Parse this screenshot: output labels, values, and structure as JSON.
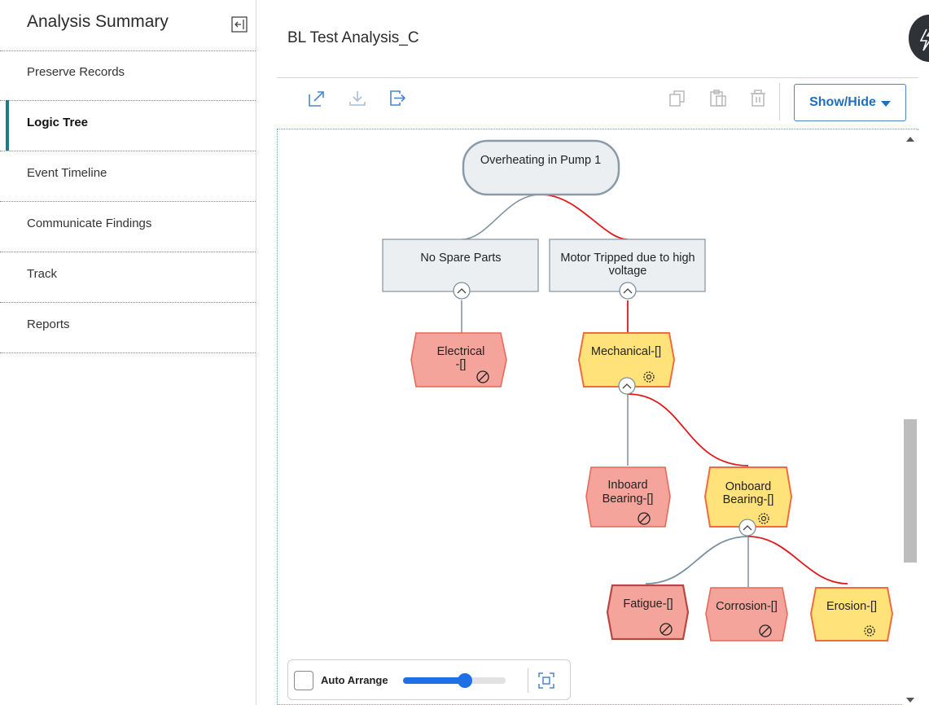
{
  "sidebar": {
    "title": "Analysis Summary",
    "items": [
      {
        "label": "Preserve Records",
        "active": false
      },
      {
        "label": "Logic Tree",
        "active": true
      },
      {
        "label": "Event Timeline",
        "active": false
      },
      {
        "label": "Communicate Findings",
        "active": false
      },
      {
        "label": "Track",
        "active": false
      },
      {
        "label": "Reports",
        "active": false
      }
    ]
  },
  "header": {
    "title": "BL Test Analysis_C"
  },
  "toolbar": {
    "show_hide_label": "Show/Hide",
    "icons": [
      "expand-icon",
      "download-icon",
      "export-icon",
      "copy-icon",
      "paste-icon",
      "delete-icon"
    ]
  },
  "tree": {
    "root": "Overheating in Pump 1",
    "nodes": {
      "no_spare_parts": "No Spare Parts",
      "motor_tripped_line1": "Motor Tripped due to high",
      "motor_tripped_line2": "voltage",
      "electrical_line1": "Electrical",
      "electrical_line2": "-[]",
      "mechanical": "Mechanical-[]",
      "inboard_line1": "Inboard",
      "inboard_line2": "Bearing-[]",
      "onboard_line1": "Onboard",
      "onboard_line2": "Bearing-[]",
      "fatigue": "Fatigue-[]",
      "corrosion": "Corrosion-[]",
      "erosion": "Erosion-[]"
    },
    "colors": {
      "hypothesis_fill": "#f5a49c",
      "hypothesis_stroke": "#e66a5a",
      "mode_fill": "#ffe27a",
      "mode_stroke": "#f26b3a",
      "gray_node_fill": "#eceff2",
      "gray_node_stroke": "#8a9aa8",
      "link_red": "#e1191b",
      "link_gray": "#7b8f9c"
    }
  },
  "controls": {
    "auto_arrange_label": "Auto Arrange",
    "zoom_level": 0.6
  }
}
